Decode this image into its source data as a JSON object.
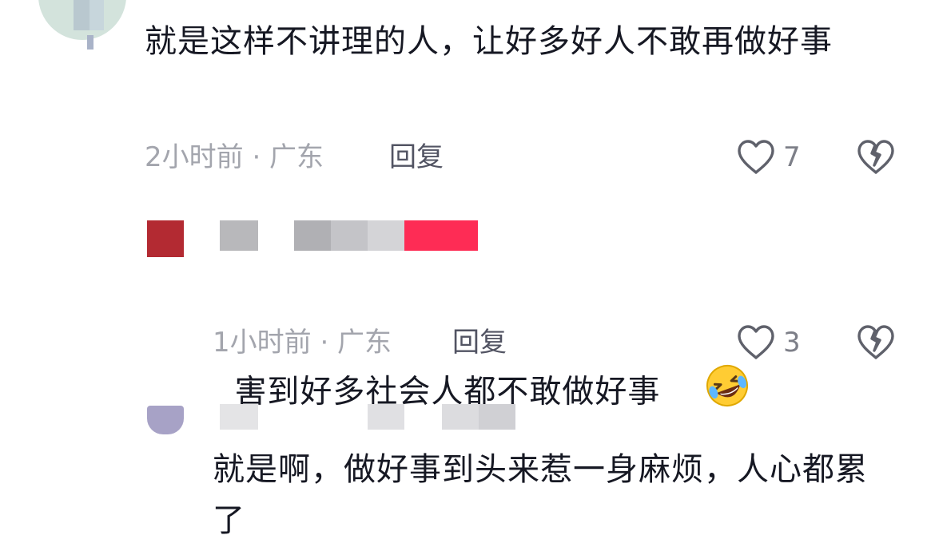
{
  "comments": [
    {
      "text": "就是这样不讲理的人，让好多好人不敢再做好事",
      "time_location": "2小时前 · 广东",
      "reply_label": "回复",
      "like_count": "7"
    },
    {
      "text": "害到好多社会人都不敢做好事",
      "emoji": "rolling-on-floor-laughing-emoji",
      "time_location": "1小时前 · 广东",
      "reply_label": "回复",
      "like_count": "3"
    },
    {
      "text": "就是啊，做好事到头来惹一身麻烦，人心都累了"
    }
  ],
  "icons": {
    "like": "heart-outline-icon",
    "dislike": "broken-heart-icon"
  },
  "colors": {
    "text": "#161823",
    "meta": "#a3a5ad",
    "reply": "#525463",
    "icon": "#5f616b",
    "accent": "#fe2c55",
    "avatar_red": "#b32a32",
    "avatar_purple": "#a7a2c6"
  }
}
